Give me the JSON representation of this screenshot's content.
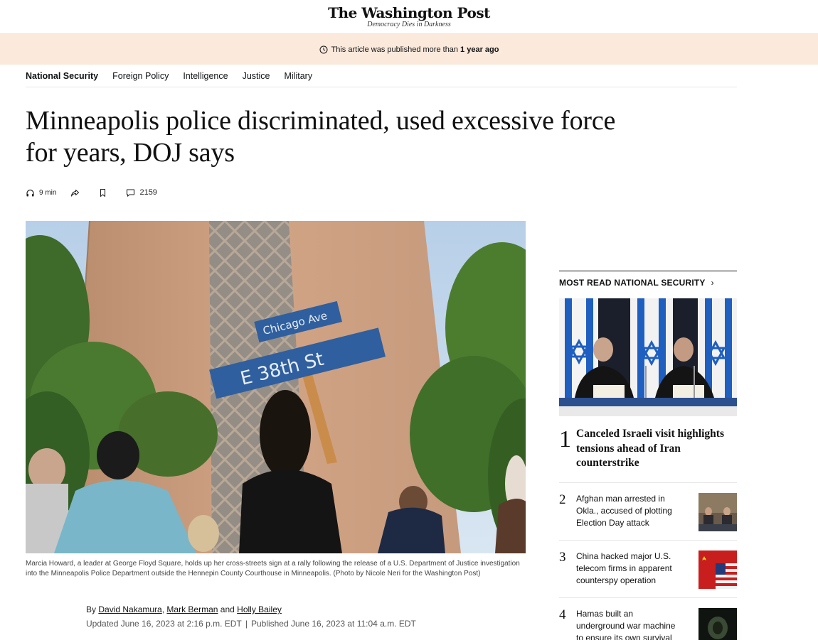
{
  "masthead": {
    "logo": "The Washington Post",
    "tagline": "Democracy Dies in Darkness"
  },
  "banner": {
    "prefix": "This article was published more than",
    "emphasis": "1 year ago",
    "icon": "clock-icon"
  },
  "section_nav": [
    {
      "label": "National Security",
      "active": true
    },
    {
      "label": "Foreign Policy",
      "active": false
    },
    {
      "label": "Intelligence",
      "active": false
    },
    {
      "label": "Justice",
      "active": false
    },
    {
      "label": "Military",
      "active": false
    }
  ],
  "headline": "Minneapolis police discriminated, used excessive force for years, DOJ says",
  "utility": {
    "listen_label": "9 min",
    "comments_count": "2159",
    "icons": [
      "headphones-icon",
      "share-icon",
      "bookmark-icon",
      "comment-icon"
    ]
  },
  "hero": {
    "caption": "Marcia Howard, a leader at George Floyd Square, holds up her cross-streets sign at a rally following the release of a U.S. Department of Justice investigation into the Minneapolis Police Department outside the Hennepin County Courthouse in Minneapolis. (Photo by Nicole Neri for the Washington Post)",
    "sign_top": "Chicago Ave",
    "sign_bottom": "E 38th St"
  },
  "byline": {
    "prefix": "By",
    "authors": [
      "David Nakamura",
      "Mark Berman",
      "Holly Bailey"
    ],
    "joiner_comma": ",",
    "joiner_and": "and",
    "updated": "Updated June 16, 2023 at 2:16 p.m. EDT",
    "separator": "|",
    "published": "Published June 16, 2023 at 11:04 a.m. EDT"
  },
  "most_read": {
    "title": "MOST READ NATIONAL SECURITY",
    "chevron": "›",
    "items": [
      {
        "num": "1",
        "text": "Canceled Israeli visit highlights tensions ahead of Iran counterstrike"
      },
      {
        "num": "2",
        "text": "Afghan man arrested in Okla., accused of plotting Election Day attack"
      },
      {
        "num": "3",
        "text": "China hacked major U.S. telecom firms in apparent counterspy operation"
      },
      {
        "num": "4",
        "text": "Hamas built an underground war machine to ensure its own survival"
      }
    ]
  },
  "colors": {
    "banner_bg": "#fbe9dc",
    "text": "#111111",
    "rule": "#e6e6e6"
  }
}
